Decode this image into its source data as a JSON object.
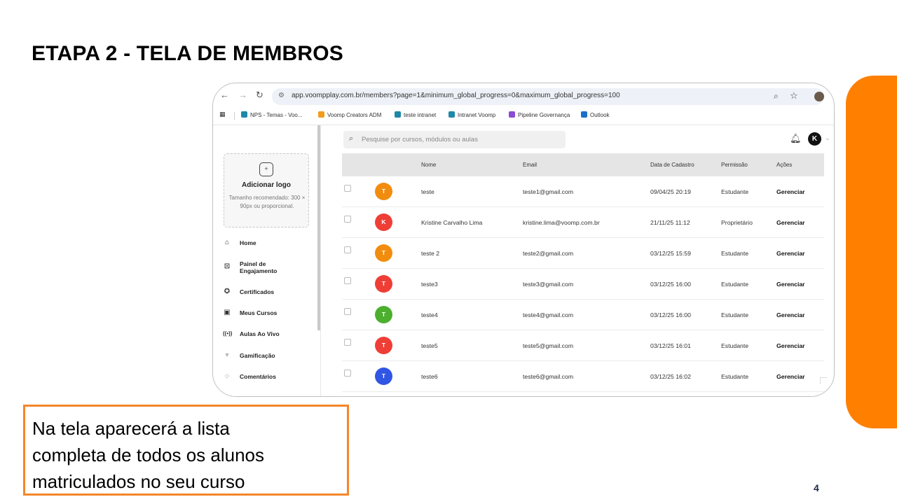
{
  "slide": {
    "title": "ETAPA 2 - TELA DE MEMBROS",
    "caption_lines": [
      "Na tela aparecerá a lista",
      "completa de todos os alunos",
      "matriculados no seu curso"
    ],
    "page_number": "4",
    "accent_color": "#ff7f00"
  },
  "browser": {
    "url": "app.voompplay.com.br/members?page=1&minimum_global_progress=0&maximum_global_progress=100",
    "bookmarks": [
      {
        "label": "NPS - Temas - Voo...",
        "color": "#1e88a8"
      },
      {
        "label": "Voomp Creators ADM",
        "color": "#f29b1d"
      },
      {
        "label": "teste intranet",
        "color": "#1e88a8"
      },
      {
        "label": "Intranet Voomp",
        "color": "#1e88a8"
      },
      {
        "label": "Pipeline Governança",
        "color": "#8a4bd6"
      },
      {
        "label": "Outlook",
        "color": "#1b6fc9"
      }
    ]
  },
  "sidebar": {
    "logo_title": "Adicionar logo",
    "logo_hint": "Tamanho recomendado: 300 × 90px ou proporcional.",
    "items": [
      {
        "label": "Home",
        "icon": "home-icon"
      },
      {
        "label": "Painel de Engajamento",
        "icon": "chart-icon"
      },
      {
        "label": "Certificados",
        "icon": "award-icon"
      },
      {
        "label": "Meus Cursos",
        "icon": "calendar-icon"
      },
      {
        "label": "Aulas Ao Vivo",
        "icon": "broadcast-icon"
      },
      {
        "label": "Gamificação",
        "icon": "trophy-icon"
      },
      {
        "label": "Comentários",
        "icon": "comment-icon"
      }
    ]
  },
  "search": {
    "placeholder": "Pesquise por cursos, módulos ou aulas"
  },
  "user": {
    "initial": "K"
  },
  "table": {
    "headers": {
      "name": "Nome",
      "email": "Email",
      "date": "Data de Cadastro",
      "permission": "Permissão",
      "actions": "Ações"
    },
    "rows": [
      {
        "initial": "T",
        "color": "#f28c0f",
        "name": "teste",
        "email": "teste1@gmail.com",
        "date": "09/04/25 20:19",
        "permission": "Estudante",
        "action": "Gerenciar"
      },
      {
        "initial": "K",
        "color": "#ef3e36",
        "name": "Kristine Carvalho Lima",
        "email": "kristine.lima@voomp.com.br",
        "date": "21/11/25 11:12",
        "permission": "Proprietário",
        "action": "Gerenciar"
      },
      {
        "initial": "T",
        "color": "#f28c0f",
        "name": "teste 2",
        "email": "teste2@gmail.com",
        "date": "03/12/25 15:59",
        "permission": "Estudante",
        "action": "Gerenciar"
      },
      {
        "initial": "T",
        "color": "#ef3e36",
        "name": "teste3",
        "email": "teste3@gmail.com",
        "date": "03/12/25 16:00",
        "permission": "Estudante",
        "action": "Gerenciar"
      },
      {
        "initial": "T",
        "color": "#4caf2e",
        "name": "teste4",
        "email": "teste4@gmail.com",
        "date": "03/12/25 16:00",
        "permission": "Estudante",
        "action": "Gerenciar"
      },
      {
        "initial": "T",
        "color": "#ef3e36",
        "name": "teste5",
        "email": "teste5@gmail.com",
        "date": "03/12/25 16:01",
        "permission": "Estudante",
        "action": "Gerenciar"
      },
      {
        "initial": "T",
        "color": "#3056e3",
        "name": "teste6",
        "email": "teste6@gmail.com",
        "date": "03/12/25 16:02",
        "permission": "Estudante",
        "action": "Gerenciar"
      }
    ]
  }
}
